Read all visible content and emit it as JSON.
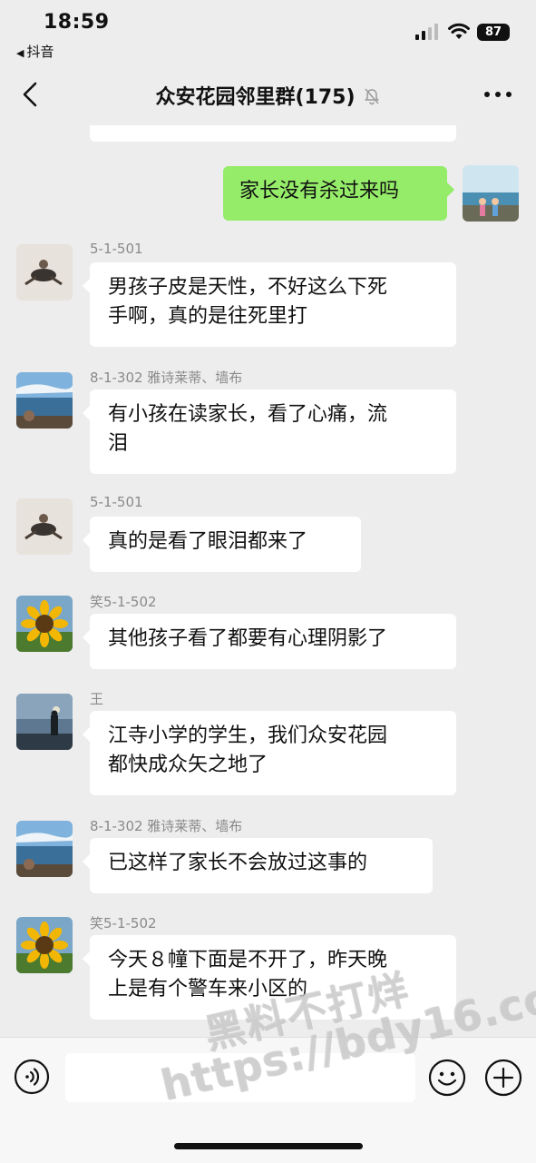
{
  "status": {
    "time": "18:59",
    "back_app": "抖音",
    "battery": "87"
  },
  "header": {
    "title": "众安花园邻里群(175)"
  },
  "messages": [
    {
      "sender": "",
      "text": "家长没有杀过来吗",
      "mine": true
    },
    {
      "sender": "5-1-501",
      "text": "男孩子皮是天性，不好这么下死手啊，真的是往死里打",
      "lines": [
        "男孩子皮是天性，不好这么下死",
        "手啊，真的是往死里打"
      ]
    },
    {
      "sender": "8-1-302 雅诗莱蒂、墙布",
      "text": "有小孩在读家长，看了心痛，流泪",
      "lines": [
        "有小孩在读家长，看了心痛，流",
        "泪"
      ]
    },
    {
      "sender": "5-1-501",
      "text": "真的是看了眼泪都来了",
      "lines": [
        "真的是看了眼泪都来了"
      ]
    },
    {
      "sender": "笑5-1-502",
      "text": "其他孩子看了都要有心理阴影了",
      "lines": [
        "其他孩子看了都要有心理阴影了"
      ]
    },
    {
      "sender": "王",
      "text": "江寺小学的学生，我们众安花园都快成众矢之地了",
      "lines": [
        "江寺小学的学生，我们众安花园",
        "都快成众矢之地了"
      ]
    },
    {
      "sender": "8-1-302 雅诗莱蒂、墙布",
      "text": "已这样了家长不会放过这事的",
      "lines": [
        "已这样了家长不会放过这事的"
      ]
    },
    {
      "sender": "笑5-1-502",
      "text": "今天８幢下面是不开了，昨天晚上是有个警车来小区的",
      "lines": [
        "今天８幢下面是不开了，昨天晚",
        "上是有个警车来小区的"
      ]
    }
  ],
  "watermark": {
    "line1": "黑料不打烊",
    "line2": "https://bdy16.co"
  },
  "icons": {
    "back": "chevron-left-icon",
    "mute": "bell-slash-icon",
    "more": "ellipsis-icon",
    "voice": "voice-icon",
    "emoji": "smiley-icon",
    "plus": "plus-icon"
  },
  "colors": {
    "background": "#ededed",
    "my_bubble": "#95ec69",
    "other_bubble": "#ffffff",
    "sender_name": "#8a8a8a"
  }
}
